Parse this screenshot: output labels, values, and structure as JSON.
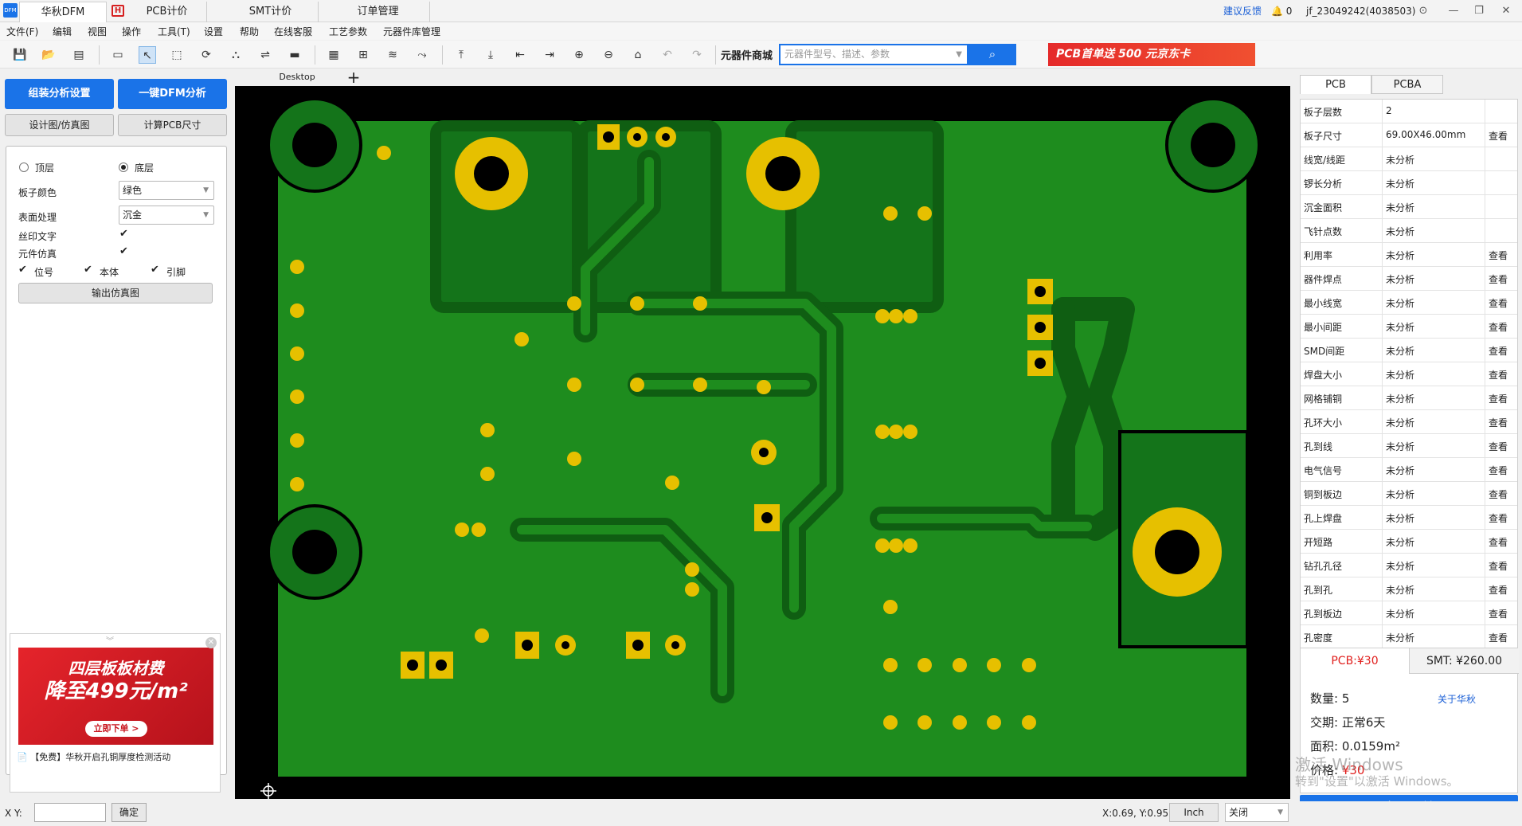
{
  "titlebar": {
    "tabs": [
      {
        "label": "华秋DFM"
      },
      {
        "label": "PCB计价"
      },
      {
        "label": "SMT计价"
      },
      {
        "label": "订单管理"
      }
    ],
    "feedback": "建议反馈",
    "notification_count": "0",
    "user": "jf_23049242(4038503)"
  },
  "menu": [
    "文件(F)",
    "编辑",
    "视图",
    "操作",
    "工具(T)",
    "设置",
    "帮助",
    "在线客服",
    "工艺参数",
    "元器件库管理"
  ],
  "toolbar": {
    "shop_label": "元器件商城",
    "search_placeholder": "元器件型号、描述、参数",
    "promo": "PCB首单送 500 元京东卡"
  },
  "left": {
    "btn_assembly": "组装分析设置",
    "btn_dfm": "一键DFM分析",
    "btn_design": "设计图/仿真图",
    "btn_calc": "计算PCB尺寸",
    "top_layer": "顶层",
    "bottom_layer": "底层",
    "board_color_label": "板子颜色",
    "board_color_value": "绿色",
    "surface_label": "表面处理",
    "surface_value": "沉金",
    "silk_label": "丝印文字",
    "comp_sim_label": "元件仿真",
    "ref_label": "位号",
    "body_label": "本体",
    "pin_label": "引脚",
    "export_btn": "输出仿真图",
    "ad_line1": "四层板板材费",
    "ad_line2": "降至499元/m²",
    "ad_cta": "立即下单 >",
    "ad_caption": "【免费】华秋开启孔铜厚度检测活动"
  },
  "canvas": {
    "tab_label": "Desktop"
  },
  "right": {
    "tab_pcb": "PCB",
    "tab_pcba": "PCBA",
    "properties": [
      {
        "name": "板子层数",
        "value": "2",
        "action": ""
      },
      {
        "name": "板子尺寸",
        "value": "69.00X46.00mm",
        "action": "查看"
      },
      {
        "name": "线宽/线距",
        "value": "未分析",
        "action": ""
      },
      {
        "name": "锣长分析",
        "value": "未分析",
        "action": ""
      },
      {
        "name": "沉金面积",
        "value": "未分析",
        "action": ""
      },
      {
        "name": "飞针点数",
        "value": "未分析",
        "action": ""
      },
      {
        "name": "利用率",
        "value": "未分析",
        "action": "查看"
      },
      {
        "name": "器件焊点",
        "value": "未分析",
        "action": "查看"
      },
      {
        "name": "最小线宽",
        "value": "未分析",
        "action": "查看"
      },
      {
        "name": "最小间距",
        "value": "未分析",
        "action": "查看"
      },
      {
        "name": "SMD间距",
        "value": "未分析",
        "action": "查看"
      },
      {
        "name": "焊盘大小",
        "value": "未分析",
        "action": "查看"
      },
      {
        "name": "网格铺铜",
        "value": "未分析",
        "action": "查看"
      },
      {
        "name": "孔环大小",
        "value": "未分析",
        "action": "查看"
      },
      {
        "name": "孔到线",
        "value": "未分析",
        "action": "查看"
      },
      {
        "name": "电气信号",
        "value": "未分析",
        "action": "查看"
      },
      {
        "name": "铜到板边",
        "value": "未分析",
        "action": "查看"
      },
      {
        "name": "孔上焊盘",
        "value": "未分析",
        "action": "查看"
      },
      {
        "name": "开短路",
        "value": "未分析",
        "action": "查看"
      },
      {
        "name": "钻孔孔径",
        "value": "未分析",
        "action": "查看"
      },
      {
        "name": "孔到孔",
        "value": "未分析",
        "action": "查看"
      },
      {
        "name": "孔到板边",
        "value": "未分析",
        "action": "查看"
      },
      {
        "name": "孔密度",
        "value": "未分析",
        "action": "查看"
      }
    ],
    "price_tab_pcb": "PCB:¥30",
    "price_tab_smt": "SMT: ¥260.00",
    "qty_label": "数量:",
    "qty_value": "5",
    "about": "关于华秋",
    "lead_label": "交期:",
    "lead_value": "正常6天",
    "area_label": "面积:",
    "area_value": "0.0159m²",
    "price_label": "价格:",
    "price_value": "¥30",
    "order_btn": "立即下单",
    "watermark1": "激活 Windows",
    "watermark2": "转到\"设置\"以激活 Windows。"
  },
  "status": {
    "xy_label": "X Y:",
    "confirm": "确定",
    "coords": "X:0.69, Y:0.95",
    "unit": "Inch",
    "toggle": "关闭"
  },
  "colors": {
    "accent": "#1a73e8",
    "board_green": "#1e8c1e",
    "copper_dark": "#0f5e12",
    "pad_gold": "#e6c000",
    "price_red": "#e0201e"
  }
}
